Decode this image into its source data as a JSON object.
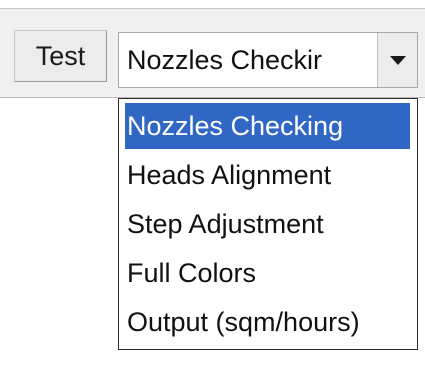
{
  "toolbar": {
    "test_button_label": "Test",
    "select": {
      "value": "Nozzles Checkir",
      "options": [
        {
          "label": "Nozzles Checking",
          "selected": true
        },
        {
          "label": "Heads Alignment",
          "selected": false
        },
        {
          "label": "Step Adjustment",
          "selected": false
        },
        {
          "label": "Full Colors",
          "selected": false
        },
        {
          "label": "Output (sqm/hours)",
          "selected": false
        }
      ],
      "arrow_icon": "chevron-down-icon"
    }
  },
  "colors": {
    "toolbar_bg": "#f0f0f0",
    "highlight": "#3167c4",
    "highlight_text": "#ffffff"
  }
}
